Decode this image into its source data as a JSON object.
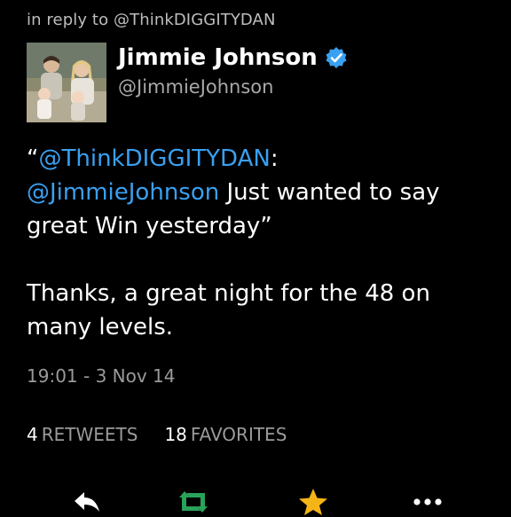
{
  "reply": {
    "prefix": "in reply to",
    "handle": "@ThinkDIGGITYDAN"
  },
  "author": {
    "name": "Jimmie Johnson",
    "handle": "@JimmieJohnson",
    "verified": true,
    "avatar_icon": "family-photo-avatar"
  },
  "tweet": {
    "line1_open_quote": "“",
    "line1_mention": "@ThinkDIGGITYDAN",
    "line1_colon": ":",
    "line2_mention": "@JimmieJohnson",
    "line2_text": " Just wanted to say",
    "line3_text": "great Win yesterday”",
    "reply_line1": "Thanks, a great night for the 48 on",
    "reply_line2": "many levels."
  },
  "timestamp": "19:01 - 3 Nov 14",
  "stats": {
    "retweets_count": "4",
    "retweets_label": "RETWEETS",
    "favorites_count": "18",
    "favorites_label": "FAVORITES"
  },
  "actions": [
    {
      "name": "reply",
      "icon": "reply-arrow-icon",
      "color": "#ffffff"
    },
    {
      "name": "retweet",
      "icon": "retweet-icon",
      "color": "#29a35a"
    },
    {
      "name": "favorite",
      "icon": "star-icon",
      "color": "#f5b418"
    },
    {
      "name": "more",
      "icon": "more-dots-icon",
      "color": "#ffffff"
    }
  ],
  "colors": {
    "background": "#000000",
    "link": "#3aa0f0",
    "verified_badge": "#3aa0f0",
    "muted_text": "#9a9a9a"
  }
}
